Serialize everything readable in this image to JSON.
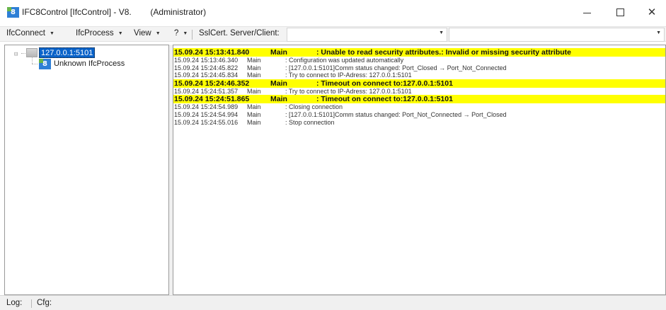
{
  "window": {
    "title": "IFC8Control [IfcControl] - V8.        (Administrator)",
    "icon": "ifc8-app-icon",
    "controls": {
      "minimize": "minimize-icon",
      "maximize": "maximize-icon",
      "close": "close-icon"
    },
    "close_glyph": "✕"
  },
  "menu": {
    "items": [
      {
        "label": "IfcConnect",
        "arrow": "▼"
      },
      {
        "label": "IfcProcess",
        "arrow": "▼"
      },
      {
        "label": "View",
        "arrow": "▼"
      },
      {
        "label": "?",
        "arrow": "▼"
      }
    ],
    "ssl_label": "SslCert. Server/Client:",
    "ssl_combo_value": "",
    "right_combo_value": "",
    "combo_arrow": "▼"
  },
  "tree": {
    "expander": "⊟",
    "host": "127.0.0.1:5101",
    "process": "Unknown IfcProcess",
    "process_icon_glyph": "8"
  },
  "log": {
    "rows": [
      {
        "ts": "15.09.24 15:13:41.840",
        "src": "Main",
        "msg": ": Unable to read security attributes.: Invalid or missing security attribute",
        "level": "warn"
      },
      {
        "ts": "15.09.24 15:13:46.340",
        "src": "Main",
        "msg": ": Configuration was updated automatically",
        "level": "info"
      },
      {
        "ts": "15.09.24 15:24:45.822",
        "src": "Main",
        "msg": ": [127.0.0.1:5101]Comm status changed: Port_Closed → Port_Not_Connected",
        "level": "info"
      },
      {
        "ts": "15.09.24 15:24:45.834",
        "src": "Main",
        "msg": ": Try to connect to IP-Adress: 127.0.0.1:5101",
        "level": "info"
      },
      {
        "ts": "15.09.24 15:24:46.352",
        "src": "Main",
        "msg": ": Timeout on connect to:127.0.0.1:5101",
        "level": "warn"
      },
      {
        "ts": "15.09.24 15:24:51.357",
        "src": "Main",
        "msg": ": Try to connect to IP-Adress: 127.0.0.1:5101",
        "level": "info"
      },
      {
        "ts": "15.09.24 15:24:51.865",
        "src": "Main",
        "msg": ": Timeout on connect to:127.0.0.1:5101",
        "level": "warn"
      },
      {
        "ts": "15.09.24 15:24:54.989",
        "src": "Main",
        "msg": ": Closing connection",
        "level": "info"
      },
      {
        "ts": "15.09.24 15:24:54.994",
        "src": "Main",
        "msg": ": [127.0.0.1:5101]Comm status changed: Port_Not_Connected → Port_Closed",
        "level": "info"
      },
      {
        "ts": "15.09.24 15:24:55.016",
        "src": "Main",
        "msg": ": Stop connection",
        "level": "info"
      }
    ],
    "warn_color": "#ffff00"
  },
  "status_tabs": [
    "Log:",
    "Cfg:"
  ]
}
